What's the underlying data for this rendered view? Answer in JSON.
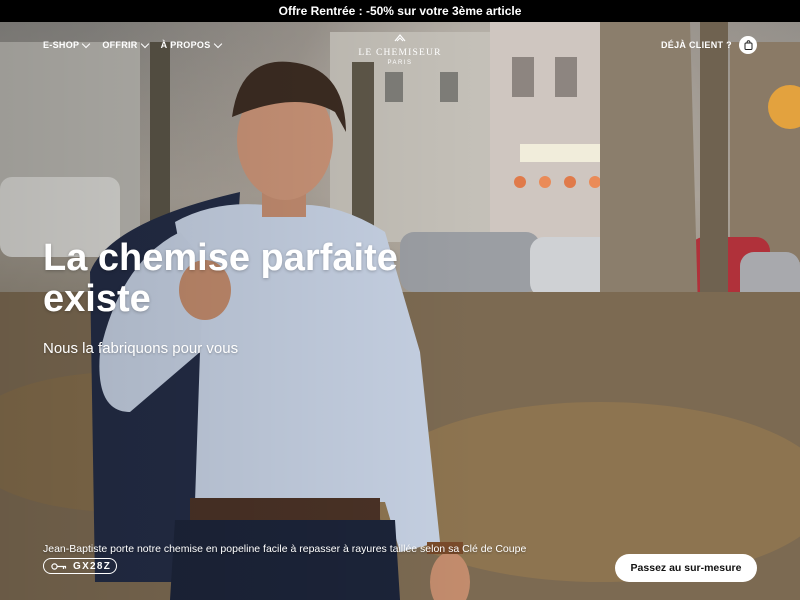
{
  "promo": {
    "text": "Offre Rentrée : -50% sur votre 3ème article"
  },
  "nav": {
    "items": [
      {
        "label": "E-SHOP"
      },
      {
        "label": "OFFRIR"
      },
      {
        "label": "À PROPOS"
      }
    ],
    "logo": {
      "name": "LE CHEMISEUR",
      "city": "PARIS"
    },
    "account_label": "DÉJÀ CLIENT ?",
    "cart_icon": "bag-icon"
  },
  "hero": {
    "title_line1": "La chemise parfaite",
    "title_line2": "existe",
    "subtitle": "Nous la fabriquons pour vous",
    "caption": "Jean-Baptiste porte notre chemise en popeline facile à repasser à rayures taillée selon sa Clé de Coupe",
    "fit_code": "GX28Z",
    "fit_code_icon": "key-icon",
    "cta_label": "Passez au sur-mesure"
  },
  "colors": {
    "promo_bg": "#000000",
    "cta_bg": "#ffffff",
    "text": "#ffffff"
  }
}
